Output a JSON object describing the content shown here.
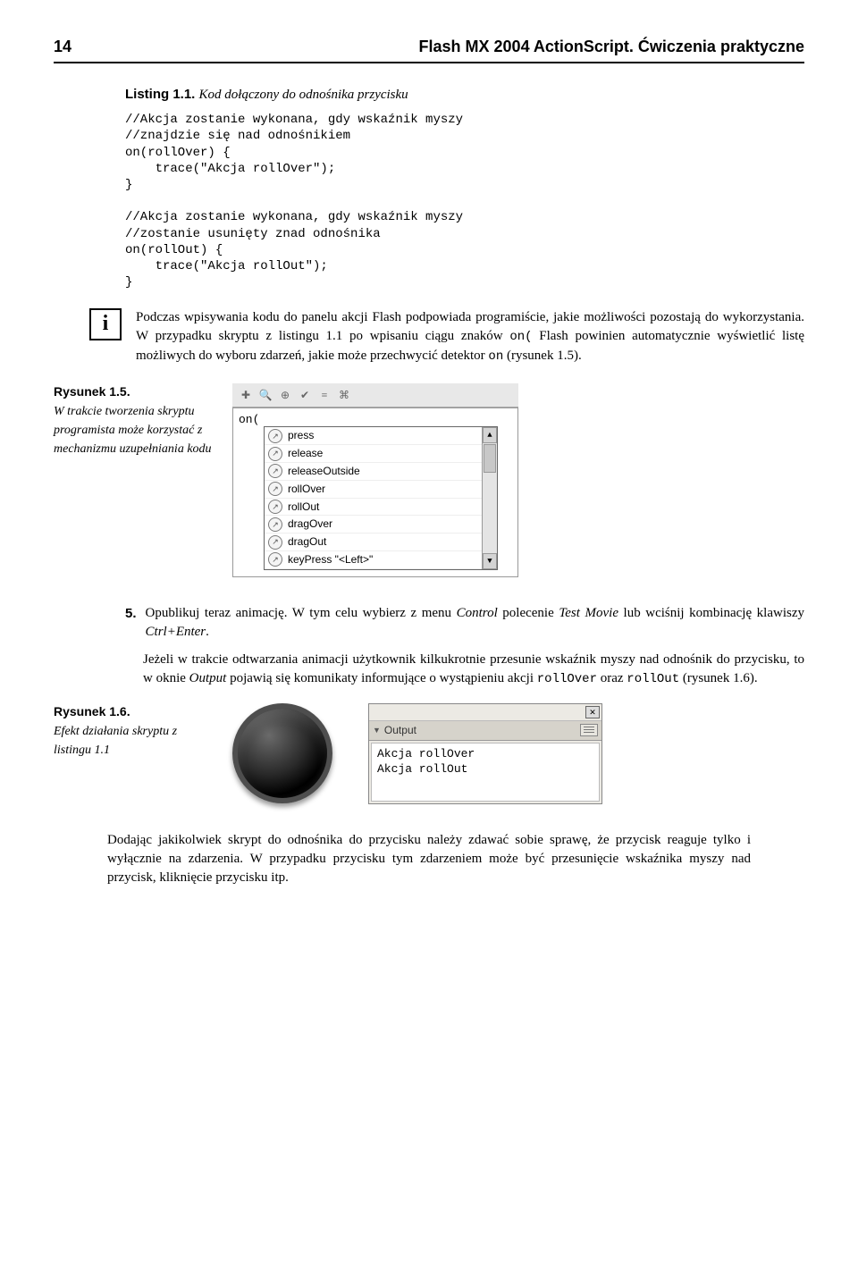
{
  "header": {
    "page_number": "14",
    "book_title": "Flash MX 2004 ActionScript. Ćwiczenia praktyczne"
  },
  "listing": {
    "label": "Listing 1.1.",
    "caption": "Kod dołączony do odnośnika przycisku",
    "code": "//Akcja zostanie wykonana, gdy wskaźnik myszy\n//znajdzie się nad odnośnikiem\non(rollOver) {\n    trace(\"Akcja rollOver\");\n}\n\n//Akcja zostanie wykonana, gdy wskaźnik myszy\n//zostanie usunięty znad odnośnika\non(rollOut) {\n    trace(\"Akcja rollOut\");\n}"
  },
  "info": {
    "p1": "Podczas wpisywania kodu do panelu akcji Flash podpowiada programiście, jakie możliwości pozostają do wykorzystania. W przypadku skryptu z listingu 1.1 po wpisaniu ciągu znaków ",
    "code1": "on(",
    "p2": " Flash powinien automatycznie wyświetlić listę możliwych do wyboru zdarzeń, jakie może przechwycić detektor ",
    "code2": "on",
    "p3": " (rysunek 1.5)."
  },
  "figure15": {
    "label": "Rysunek 1.5.",
    "desc": "W trakcie tworzenia skryptu programista może korzystać z mechanizmu uzupełniania kodu",
    "editor_text": "on(",
    "items": [
      "press",
      "release",
      "releaseOutside",
      "rollOver",
      "rollOut",
      "dragOver",
      "dragOut",
      "keyPress \"<Left>\""
    ]
  },
  "step5": {
    "num": "5.",
    "t1": "Opublikuj teraz animację. W tym celu wybierz z menu ",
    "it1": "Control",
    "t2": " polecenie ",
    "it2": "Test Movie",
    "t3": " lub wciśnij kombinację klawiszy ",
    "it3": "Ctrl+Enter",
    "t4": "."
  },
  "under_step": {
    "t1": "Jeżeli w trakcie odtwarzania animacji użytkownik kilkukrotnie przesunie wskaźnik myszy nad odnośnik do przycisku, to w oknie ",
    "it1": "Output",
    "t2": " pojawią się komunikaty informujące o wystąpieniu akcji ",
    "c1": "rollOver",
    "t3": " oraz ",
    "c2": "rollOut",
    "t4": " (rysunek 1.6)."
  },
  "figure16": {
    "label": "Rysunek 1.6.",
    "desc": "Efekt działania skryptu z listingu 1.1",
    "panel_title": "Output",
    "lines": [
      "Akcja rollOver",
      "Akcja rollOut"
    ]
  },
  "closing": {
    "text": "Dodając jakikolwiek skrypt do odnośnika do przycisku należy zdawać sobie sprawę, że przycisk reaguje tylko i wyłącznie na zdarzenia. W przypadku przycisku tym zdarzeniem może być przesunięcie wskaźnika myszy nad przycisk, kliknięcie przycisku itp."
  }
}
